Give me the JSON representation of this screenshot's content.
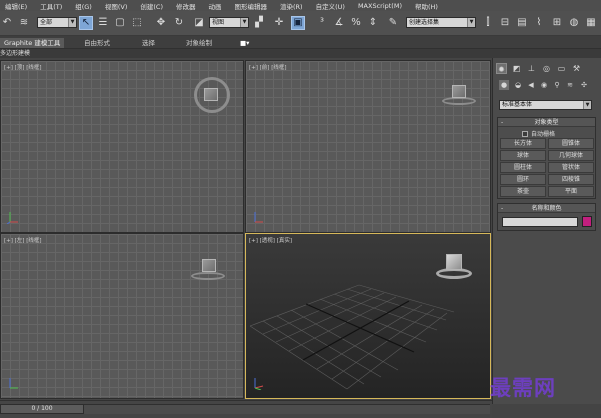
{
  "menu": [
    "编辑(E)",
    "工具(T)",
    "组(G)",
    "视图(V)",
    "创建(C)",
    "修改器",
    "动画",
    "图形编辑器",
    "渲染(R)",
    "自定义(U)",
    "MAXScript(M)",
    "帮助(H)"
  ],
  "toolbar": {
    "selection_filter": "全部",
    "ref_coord": "视图",
    "named_selection": "创建选择集",
    "icons": [
      "undo-icon",
      "bind-icon",
      "select-icon",
      "select-by-name-icon",
      "region-select-icon",
      "window-crossing-icon",
      "move-icon",
      "rotate-icon",
      "scale-icon",
      "pivot-icon",
      "select-manipulate-icon",
      "keyboard-shortcut-icon",
      "snap-icon",
      "angle-snap-icon",
      "percent-snap-icon",
      "spinner-snap-icon",
      "edit-named-selection-icon",
      "mirror-icon",
      "align-icon",
      "layer-icon",
      "curve-editor-icon",
      "schematic-icon",
      "material-editor-icon",
      "render-setup-icon",
      "render-frame-icon"
    ]
  },
  "ribbon": {
    "tabs": [
      "Graphite 建模工具",
      "自由形式",
      "选择",
      "对象绘制"
    ],
    "active_tab": "Graphite 建模工具",
    "sub_label": "多边形建模"
  },
  "viewports": [
    {
      "label": "[+] [顶] [线框]"
    },
    {
      "label": "[+] [前] [线框]"
    },
    {
      "label": "[+] [左] [线框]"
    },
    {
      "label": "[+] [透视] [真实]"
    }
  ],
  "command_panel": {
    "tabs": [
      "create-tab-icon",
      "modify-tab-icon",
      "hierarchy-tab-icon",
      "motion-tab-icon",
      "display-tab-icon",
      "utilities-tab-icon"
    ],
    "category_dropdown": "标准基本体",
    "object_type": {
      "title": "对象类型",
      "autogrid_label": "自动栅格",
      "buttons": [
        "长方体",
        "圆锥体",
        "球体",
        "几何球体",
        "圆柱体",
        "管状体",
        "圆环",
        "四棱锥",
        "茶壶",
        "平面"
      ]
    },
    "name_color": {
      "title": "名称和颜色",
      "name_value": "",
      "color": "#c21f7e"
    }
  },
  "status": {
    "time_slider": "0 / 100"
  },
  "watermark": "最需网",
  "colors": {
    "active_viewport_border": "#d6b85a",
    "watermark": "#6d3fbe",
    "object_color": "#c21f7e"
  }
}
